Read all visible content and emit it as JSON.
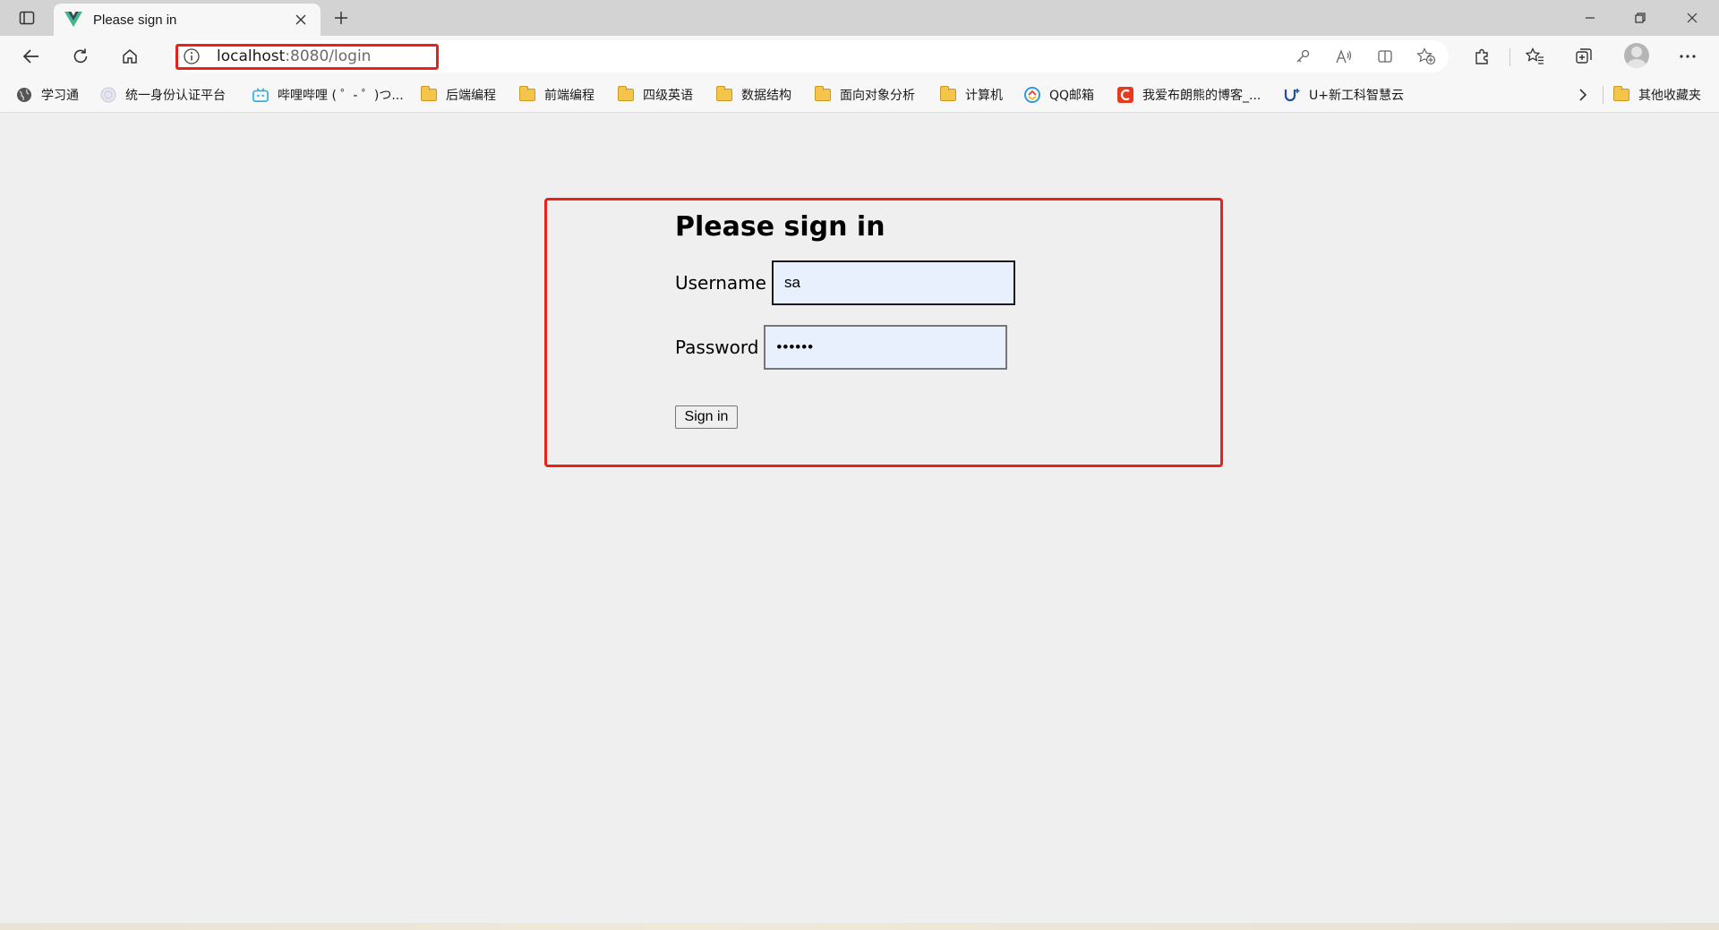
{
  "browser": {
    "tab": {
      "title": "Please sign in",
      "favicon": "vue-logo-icon"
    },
    "address_bar": {
      "host": "localhost",
      "path": ":8080/login"
    },
    "bookmarks": [
      {
        "label": "学习通",
        "icon": "globe-icon"
      },
      {
        "label": "统一身份认证平台",
        "icon": "emblem-icon"
      },
      {
        "label": "哔哩哔哩 ( ゜- ゜)つ...",
        "icon": "bilibili-icon"
      },
      {
        "label": "后端编程",
        "icon": "folder-icon"
      },
      {
        "label": "前端编程",
        "icon": "folder-icon"
      },
      {
        "label": "四级英语",
        "icon": "folder-icon"
      },
      {
        "label": "数据结构",
        "icon": "folder-icon"
      },
      {
        "label": "面向对象分析",
        "icon": "folder-icon"
      },
      {
        "label": "计算机",
        "icon": "folder-icon"
      },
      {
        "label": "QQ邮箱",
        "icon": "qqmail-icon"
      },
      {
        "label": "我爱布朗熊的博客_...",
        "icon": "csdn-icon"
      },
      {
        "label": "U+新工科智慧云",
        "icon": "u-plus-icon"
      }
    ],
    "other_favorites": "其他收藏夹"
  },
  "login_form": {
    "title": "Please sign in",
    "username_label": "Username",
    "username_value": "sa",
    "password_label": "Password",
    "password_value": "••••••",
    "submit_label": "Sign in"
  },
  "colors": {
    "highlight": "#e8211b",
    "autofill_bg": "#e8f0fe",
    "page_bg": "#efefef"
  }
}
